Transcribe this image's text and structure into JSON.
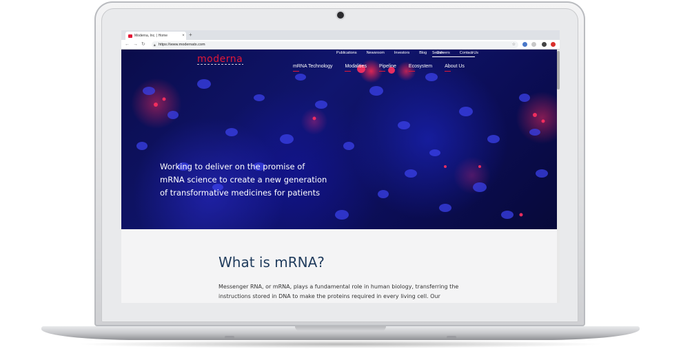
{
  "browser": {
    "tab_title": "Moderna, Inc. | Home",
    "tab_close": "×",
    "new_tab": "+",
    "url": "https://www.modernatx.com",
    "back": "←",
    "forward": "→",
    "reload": "↻"
  },
  "site": {
    "logo": "moderna",
    "utility_nav": [
      "Publications",
      "Newsroom",
      "Investors",
      "Blog",
      "Careers",
      "Contact Us"
    ],
    "search_placeholder": "Search",
    "main_nav": [
      "mRNA Technology",
      "Modalities",
      "Pipeline",
      "Ecosystem",
      "About Us"
    ],
    "hero_tagline": [
      "Working to deliver on the promise of",
      "mRNA science to create a new generation",
      "of transformative medicines for patients"
    ],
    "section_heading": "What is mRNA?",
    "section_paragraph": "Messenger RNA, or mRNA, plays a fundamental role in human biology, transferring the instructions stored in DNA to make the proteins required in every living cell. Our"
  },
  "colors": {
    "brand_red": "#e31837",
    "heading_navy": "#1f3b5c",
    "hero_blue": "#10156e"
  }
}
